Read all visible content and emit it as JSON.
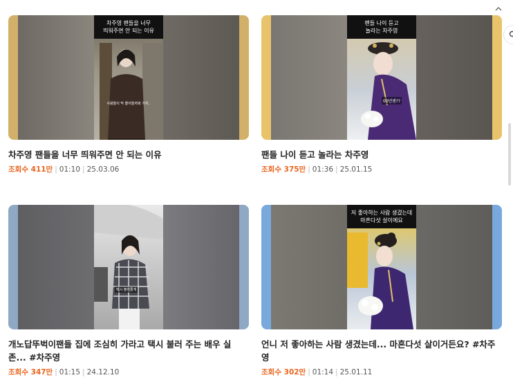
{
  "videos": [
    {
      "title": "차주영 팬들을 너무 띄워주면 안 되는 이유",
      "views": "조회수 411만",
      "duration": "01:10",
      "date": "25.03.06",
      "caption_line1": "차주영 팬들을 너무",
      "caption_line2": "띄워주면 안 되는 이유",
      "subtitle": "사람들이 막 몰아들까봐 가지..",
      "accent": "#d2b06a"
    },
    {
      "title": "팬들 나이 듣고 놀라는 차주영",
      "views": "조회수 375만",
      "duration": "01:36",
      "date": "25.01.15",
      "caption_line1": "팬들 나이 듣고",
      "caption_line2": "놀라는 차주영",
      "subtitle": "00년생??",
      "accent": "#e8c36c"
    },
    {
      "title": "개노답뚜벅이팬들 집에 조심히 가라고 택시 불러 주는 배우 실존... #차주영",
      "views": "조회수 347만",
      "duration": "01:15",
      "date": "24.12.10",
      "caption_line1": "",
      "caption_line2": "",
      "subtitle": "택시 불러줄게",
      "accent": "#8fa8c4"
    },
    {
      "title": "언니 저 좋아하는 사람 생겼는데... 마흔다섯 살이거든요? #차주영",
      "views": "조회수 302만",
      "duration": "01:14",
      "date": "25.01.11",
      "caption_line1": "저 좋아하는 사람 생겼는데",
      "caption_line2": "마흔다섯 살이에요",
      "subtitle": "",
      "accent": "#79a9dc"
    }
  ],
  "icons": {
    "scroll_up": "chevron-up-icon",
    "side_action": "search-icon"
  }
}
